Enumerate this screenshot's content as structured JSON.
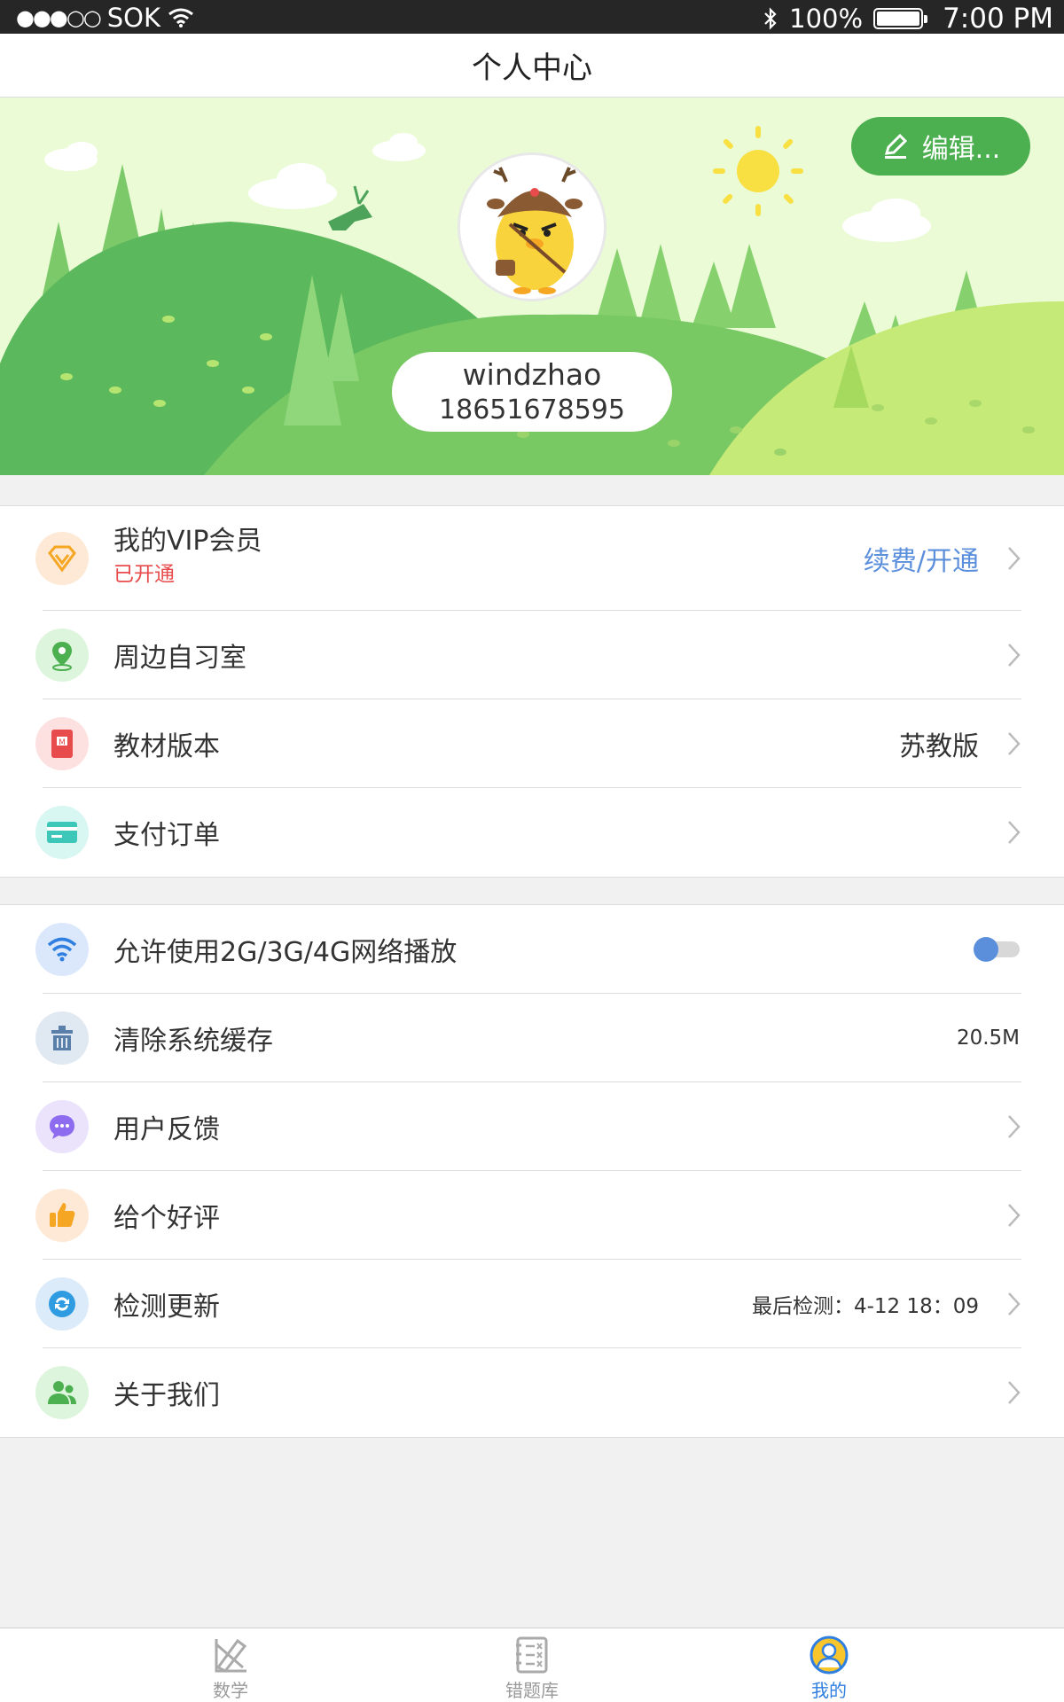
{
  "status_bar": {
    "carrier": "SOK",
    "battery": "100%",
    "time": "7:00 PM"
  },
  "nav": {
    "title": "个人中心"
  },
  "profile": {
    "edit_label": "编辑...",
    "username": "windzhao",
    "phone": "18651678595"
  },
  "group1": [
    {
      "icon": "vip-diamond-icon",
      "label": "我的VIP会员",
      "sub": "已开通",
      "value": "续费/开通",
      "accent": "#f5a623"
    },
    {
      "icon": "location-pin-icon",
      "label": "周边自习室",
      "value": "",
      "accent": "#4caf50"
    },
    {
      "icon": "textbook-icon",
      "label": "教材版本",
      "value": "苏教版",
      "accent": "#e84b4b"
    },
    {
      "icon": "payment-card-icon",
      "label": "支付订单",
      "value": "",
      "accent": "#3cc7b8"
    }
  ],
  "group2": [
    {
      "icon": "wifi-icon",
      "label": "允许使用2G/3G/4G网络播放",
      "toggle": true,
      "accent": "#2f7fe0"
    },
    {
      "icon": "trash-bin-icon",
      "label": "清除系统缓存",
      "value": "20.5M",
      "accent": "#5a7fa8"
    },
    {
      "icon": "chat-bubble-icon",
      "label": "用户反馈",
      "value": "",
      "accent": "#8e6cf0"
    },
    {
      "icon": "thumbs-up-icon",
      "label": "给个好评",
      "value": "",
      "accent": "#f5a623"
    },
    {
      "icon": "refresh-icon",
      "label": "检测更新",
      "value": "最后检测：4-12 18：09",
      "accent": "#2f9be0"
    },
    {
      "icon": "people-icon",
      "label": "关于我们",
      "value": "",
      "accent": "#4caf50"
    }
  ],
  "tabs": [
    {
      "label": "数学",
      "icon": "math-tools-icon",
      "active": false
    },
    {
      "label": "错题库",
      "icon": "notebook-icon",
      "active": false
    },
    {
      "label": "我的",
      "icon": "profile-icon",
      "active": true
    }
  ],
  "colors": {
    "brand_green": "#4caf50",
    "link_blue": "#5b8fdc",
    "alert_red": "#e84b4b",
    "tab_active": "#2f7fe0"
  }
}
